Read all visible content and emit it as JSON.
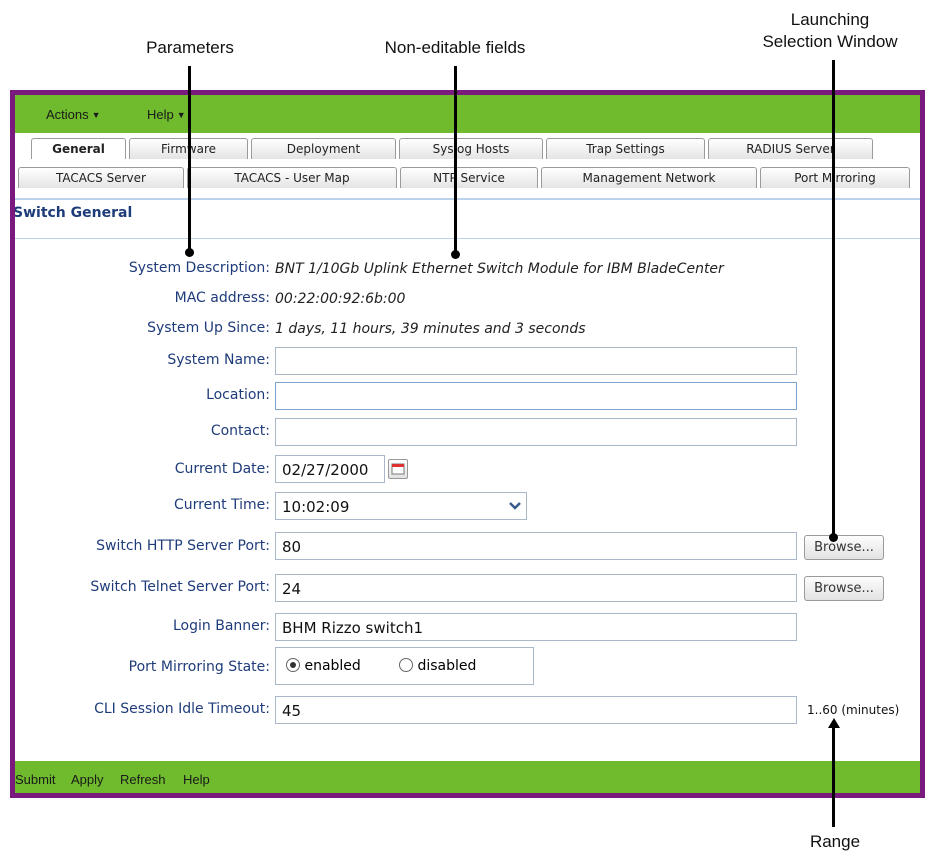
{
  "annotations": {
    "parameters": "Parameters",
    "non_editable": "Non-editable fields",
    "launching_line1": "Launching",
    "launching_line2": "Selection Window",
    "range": "Range"
  },
  "menu": {
    "actions": "Actions",
    "help": "Help"
  },
  "tabs_row1": [
    "General",
    "Firmware",
    "Deployment",
    "Syslog Hosts",
    "Trap Settings",
    "RADIUS Server"
  ],
  "tabs_row2": [
    "TACACS Server",
    "TACACS - User Map",
    "NTP Service",
    "Management Network",
    "Port Mirroring"
  ],
  "section_title": "Switch General",
  "fields": {
    "system_description": {
      "label": "System Description:",
      "value": "BNT 1/10Gb Uplink Ethernet Switch Module for IBM BladeCenter"
    },
    "mac_address": {
      "label": "MAC address:",
      "value": "00:22:00:92:6b:00"
    },
    "system_up_since": {
      "label": "System Up Since:",
      "value": "1 days, 11 hours, 39 minutes and 3 seconds"
    },
    "system_name": {
      "label": "System Name:",
      "value": ""
    },
    "location": {
      "label": "Location:",
      "value": ""
    },
    "contact": {
      "label": "Contact:",
      "value": ""
    },
    "current_date": {
      "label": "Current Date:",
      "value": "02/27/2000"
    },
    "current_time": {
      "label": "Current Time:",
      "value": "10:02:09"
    },
    "http_port": {
      "label": "Switch HTTP Server Port:",
      "value": "80",
      "button": "Browse..."
    },
    "telnet_port": {
      "label": "Switch Telnet Server Port:",
      "value": "24",
      "button": "Browse..."
    },
    "login_banner": {
      "label": "Login Banner:",
      "value": "BHM Rizzo switch1"
    },
    "port_mirroring": {
      "label": "Port Mirroring State:",
      "enabled": "enabled",
      "disabled": "disabled",
      "selected": "enabled"
    },
    "cli_timeout": {
      "label": "CLI Session Idle Timeout:",
      "value": "45",
      "range": "1..60 (minutes)"
    }
  },
  "footer": {
    "submit": "Submit",
    "apply": "Apply",
    "refresh": "Refresh",
    "help": "Help"
  },
  "colors": {
    "green_bar": "#6fbb2d",
    "frame": "#7b1a7e",
    "label_blue": "#1f3c7a"
  }
}
